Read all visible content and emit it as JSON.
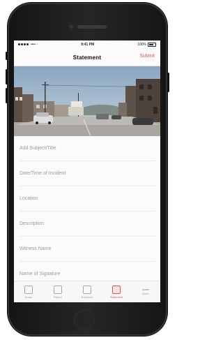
{
  "status_bar": {
    "carrier": "•••• ◦ ",
    "time": "9:41 PM",
    "battery": "100%"
  },
  "nav": {
    "title": "Statement",
    "action_label": "Submit"
  },
  "form": {
    "fields": [
      {
        "label": "Add Subject/Title"
      },
      {
        "label": "Date/Time of Incident"
      },
      {
        "label": "Location"
      },
      {
        "label": "Description"
      },
      {
        "label": "Witness Name"
      },
      {
        "label": "Name of Signature"
      }
    ]
  },
  "tabs": [
    {
      "label": "Home",
      "icon": "home-icon",
      "active": false
    },
    {
      "label": "Report",
      "icon": "report-icon",
      "active": false
    },
    {
      "label": "Evidence",
      "icon": "evidence-icon",
      "active": false
    },
    {
      "label": "Statement",
      "icon": "statement-icon",
      "active": true
    },
    {
      "label": "More",
      "icon": "more-icon",
      "active": false
    }
  ],
  "colors": {
    "accent": "#e8584e",
    "phone_body": "#1c1c1c"
  }
}
